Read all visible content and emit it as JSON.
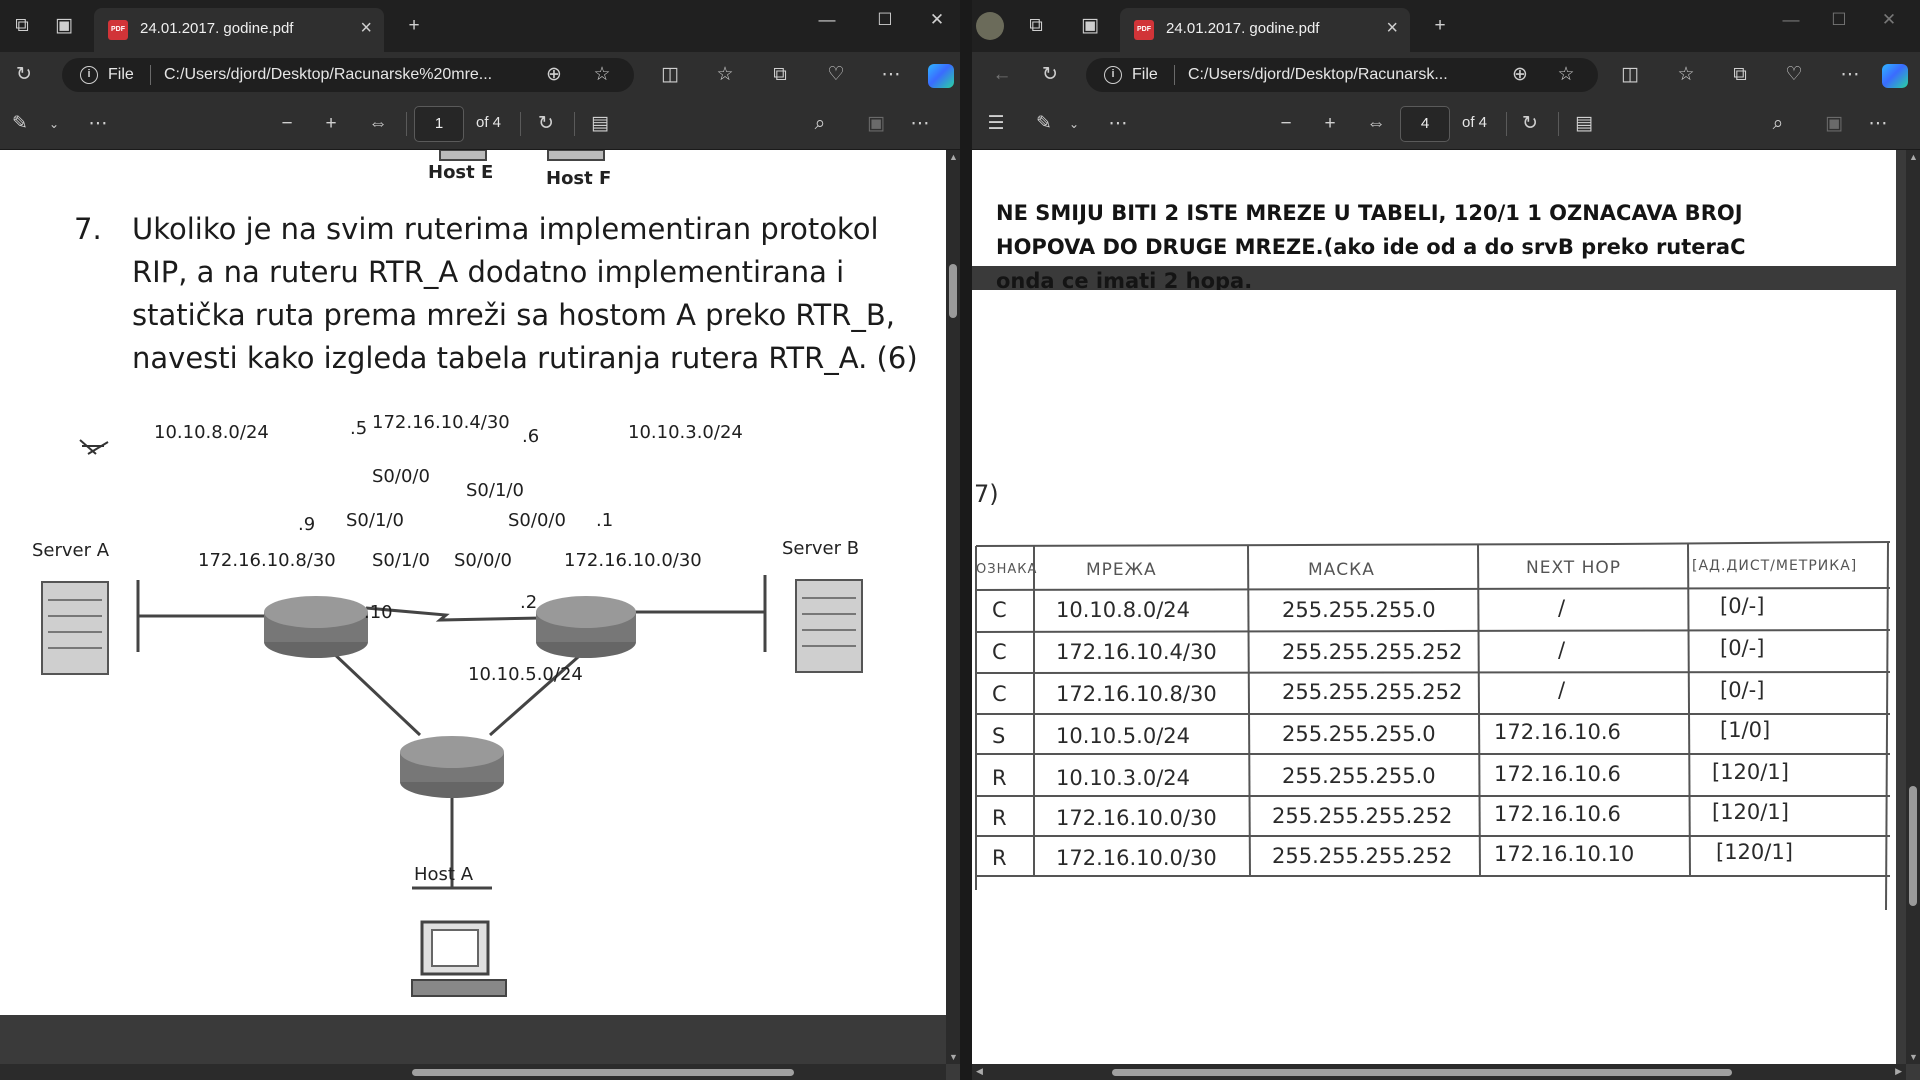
{
  "left": {
    "tab_title": "24.01.2017. godine.pdf",
    "scheme": "File",
    "url": "C:/Users/djord/Desktop/Racunarske%20mre...",
    "page_number": "1",
    "page_total": "of 4",
    "question": {
      "number": "7.",
      "lines": [
        "Ukoliko je na svim ruterima implementiran protokol",
        "RIP, a na ruteru RTR_A dodatno implementirana i",
        "statička ruta prema mreži sa hostom A preko RTR_B,",
        "navesti kako izgleda tabela rutiranja rutera RTR_A. (6)"
      ]
    },
    "diagram": {
      "host_e": "Host E",
      "host_f": "Host F",
      "server_a": "Server A",
      "server_b": "Server B",
      "host_a": "Host A",
      "net_left": "10.10.8.0/24",
      "net_right": "10.10.3.0/24",
      "net_top": "172.16.10.4/30",
      "net_ac": "172.16.10.8/30",
      "net_bc": "172.16.10.0/30",
      "net_bottom": "10.10.5.0/24",
      "if_a_s000": "S0/0/0",
      "if_a_s010": "S0/1/0",
      "if_b_s010": "S0/1/0",
      "if_b_s000": "S0/0/0",
      "if_c_s010": "S0/1/0",
      "if_c_s000": "S0/0/0",
      "ip_5": ".5",
      "ip_6": ".6",
      "ip_9": ".9",
      "ip_1": ".1",
      "ip_10": ".10",
      "ip_2": ".2"
    }
  },
  "right": {
    "tab_title": "24.01.2017. godine.pdf",
    "scheme": "File",
    "url": "C:/Users/djord/Desktop/Racunarsk...",
    "page_number": "4",
    "page_total": "of 4",
    "note_lines": [
      "NE SMIJU BITI 2 ISTE MREZE U TABELI, 120/1 1 OZNACAVA BROJ",
      "HOPOVA DO DRUGE MREZE.(ako ide od a do srvB preko ruteraC",
      "onda ce imati 2 hopa."
    ],
    "margin_mark": "7)",
    "table": {
      "headers": [
        "ОЗНАКА",
        "МРЕЖА",
        "МАСКА",
        "NEXT HOP",
        "[АД.ДИСТ/МЕТРИКА]"
      ],
      "rows": [
        [
          "C",
          "10.10.8.0/24",
          "255.255.255.0",
          "/",
          "[0/-]"
        ],
        [
          "C",
          "172.16.10.4/30",
          "255.255.255.252",
          "/",
          "[0/-]"
        ],
        [
          "C",
          "172.16.10.8/30",
          "255.255.255.252",
          "/",
          "[0/-]"
        ],
        [
          "S",
          "10.10.5.0/24",
          "255.255.255.0",
          "172.16.10.6",
          "[1/0]"
        ],
        [
          "R",
          "10.10.3.0/24",
          "255.255.255.0",
          "172.16.10.6",
          "[120/1]"
        ],
        [
          "R",
          "172.16.10.0/30",
          "255.255.255.252",
          "172.16.10.6",
          "[120/1]"
        ],
        [
          "R",
          "172.16.10.0/30",
          "255.255.255.252",
          "172.16.10.10",
          "[120/1]"
        ]
      ]
    }
  }
}
